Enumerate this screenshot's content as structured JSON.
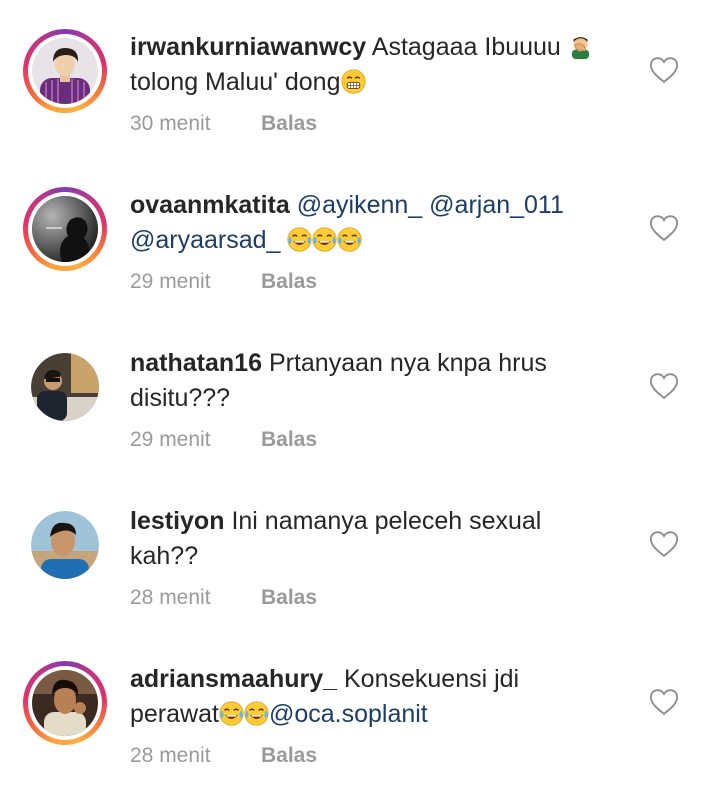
{
  "comments": [
    {
      "username": "irwankurniawanwcy",
      "text_a": "Astagaaa Ibuuuu",
      "emoji_a": "facepalm-emoji",
      "text_b": "tolong Maluu' dong",
      "emoji_b": "grimacing-emoji",
      "time": "30 menit",
      "reply": "Balas",
      "story_ring": true
    },
    {
      "username": "ovaanmkatita",
      "mention_1": "@ayikenn_",
      "mention_2": "@arjan_011",
      "mention_3": "@aryaarsad_",
      "emoji": "tears-of-joy-emoji x3",
      "time": "29 menit",
      "reply": "Balas",
      "story_ring": true
    },
    {
      "username": "nathatan16",
      "text": "Prtanyaan nya knpa hrus disitu???",
      "time": "29 menit",
      "reply": "Balas",
      "story_ring": false
    },
    {
      "username": "lestiyon",
      "text": "Ini namanya peleceh sexual kah??",
      "time": "28 menit",
      "reply": "Balas",
      "story_ring": false
    },
    {
      "username": "adriansmaahury_",
      "text_a": "Konsekuensi jdi perawat",
      "emoji": "tears-of-joy-emoji x2",
      "mention": "@oca.soplanit",
      "time": "28 menit",
      "reply": "Balas",
      "story_ring": true
    }
  ],
  "colors": {
    "username": "#262626",
    "mention": "#1b3d69",
    "meta": "#9a9a9a",
    "ring_start": "#fcaf45",
    "ring_end": "#c13584"
  },
  "icons": {
    "like": "heart-outline-icon"
  }
}
